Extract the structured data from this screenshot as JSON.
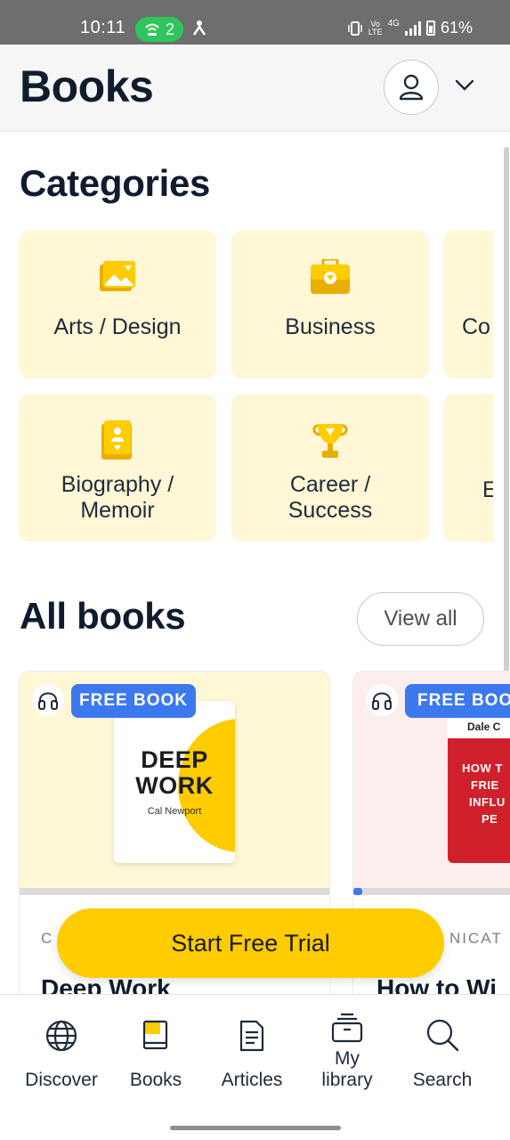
{
  "status_bar": {
    "time": "10:11",
    "hotspot_count": "2",
    "network": "4G",
    "volte": "Vo LTE",
    "battery": "61%"
  },
  "header": {
    "title": "Books"
  },
  "categories": {
    "heading": "Categories",
    "row1": [
      "Arts / Design",
      "Business",
      "Co"
    ],
    "row2": [
      "Biography /",
      "Memoir",
      "Career /",
      "Success",
      "E"
    ]
  },
  "all_books": {
    "heading": "All books",
    "view_all_label": "View all",
    "cards": [
      {
        "badge": "FREE BOOK",
        "cover_title_line1": "DEEP",
        "cover_title_line2": "WORK",
        "cover_author": "Cal Newport",
        "category_fragment": "C",
        "title": "Deep Work",
        "progress": 0
      },
      {
        "badge": "FREE BOO",
        "cover_author": "Dale C",
        "cover_lines": [
          "HOW T",
          "FRIE",
          "INFLU",
          "PE"
        ],
        "category_fragment": "NICAT",
        "title": "How to Wi",
        "progress": 0.05
      }
    ]
  },
  "cta": {
    "label": "Start Free Trial"
  },
  "bottom_nav": {
    "items": [
      {
        "label": "Discover",
        "icon": "globe-icon"
      },
      {
        "label": "Books",
        "icon": "book-icon"
      },
      {
        "label": "Articles",
        "icon": "document-icon"
      },
      {
        "label_line1": "My",
        "label_line2": "library",
        "icon": "library-icon"
      },
      {
        "label": "Search",
        "icon": "search-icon"
      }
    ]
  },
  "colors": {
    "accent_yellow": "#ffcc00",
    "tile_background": "#fff7d6",
    "badge_blue": "#3d79ee",
    "text_dark": "#0f1c2e"
  }
}
